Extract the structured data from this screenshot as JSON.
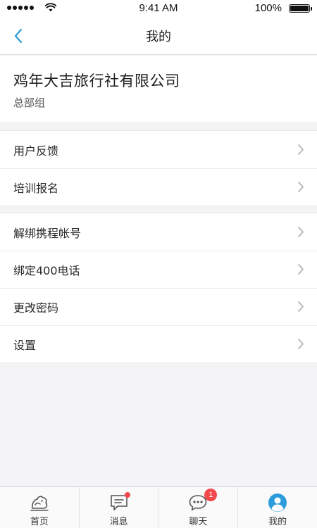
{
  "status_bar": {
    "time": "9:41 AM",
    "battery": "100%"
  },
  "nav": {
    "title": "我的",
    "back_icon": "chevron-left-icon"
  },
  "company": {
    "name": "鸡年大吉旅行社有限公司",
    "group": "总部组"
  },
  "sections": [
    {
      "items": [
        {
          "label": "用户反馈"
        },
        {
          "label": "培训报名"
        }
      ]
    },
    {
      "items": [
        {
          "label": "解绑携程帐号"
        },
        {
          "label": "绑定400电话"
        },
        {
          "label": "更改密码"
        },
        {
          "label": "设置"
        }
      ]
    }
  ],
  "tabs": [
    {
      "label": "首页",
      "icon": "home-icon",
      "active": false
    },
    {
      "label": "消息",
      "icon": "message-icon",
      "active": false,
      "badge_dot": true
    },
    {
      "label": "聊天",
      "icon": "chat-icon",
      "active": false,
      "badge": "1"
    },
    {
      "label": "我的",
      "icon": "profile-icon",
      "active": true
    }
  ],
  "colors": {
    "accent": "#2c9cdb",
    "badge": "#f2484b",
    "background": "#f4f4f6"
  }
}
